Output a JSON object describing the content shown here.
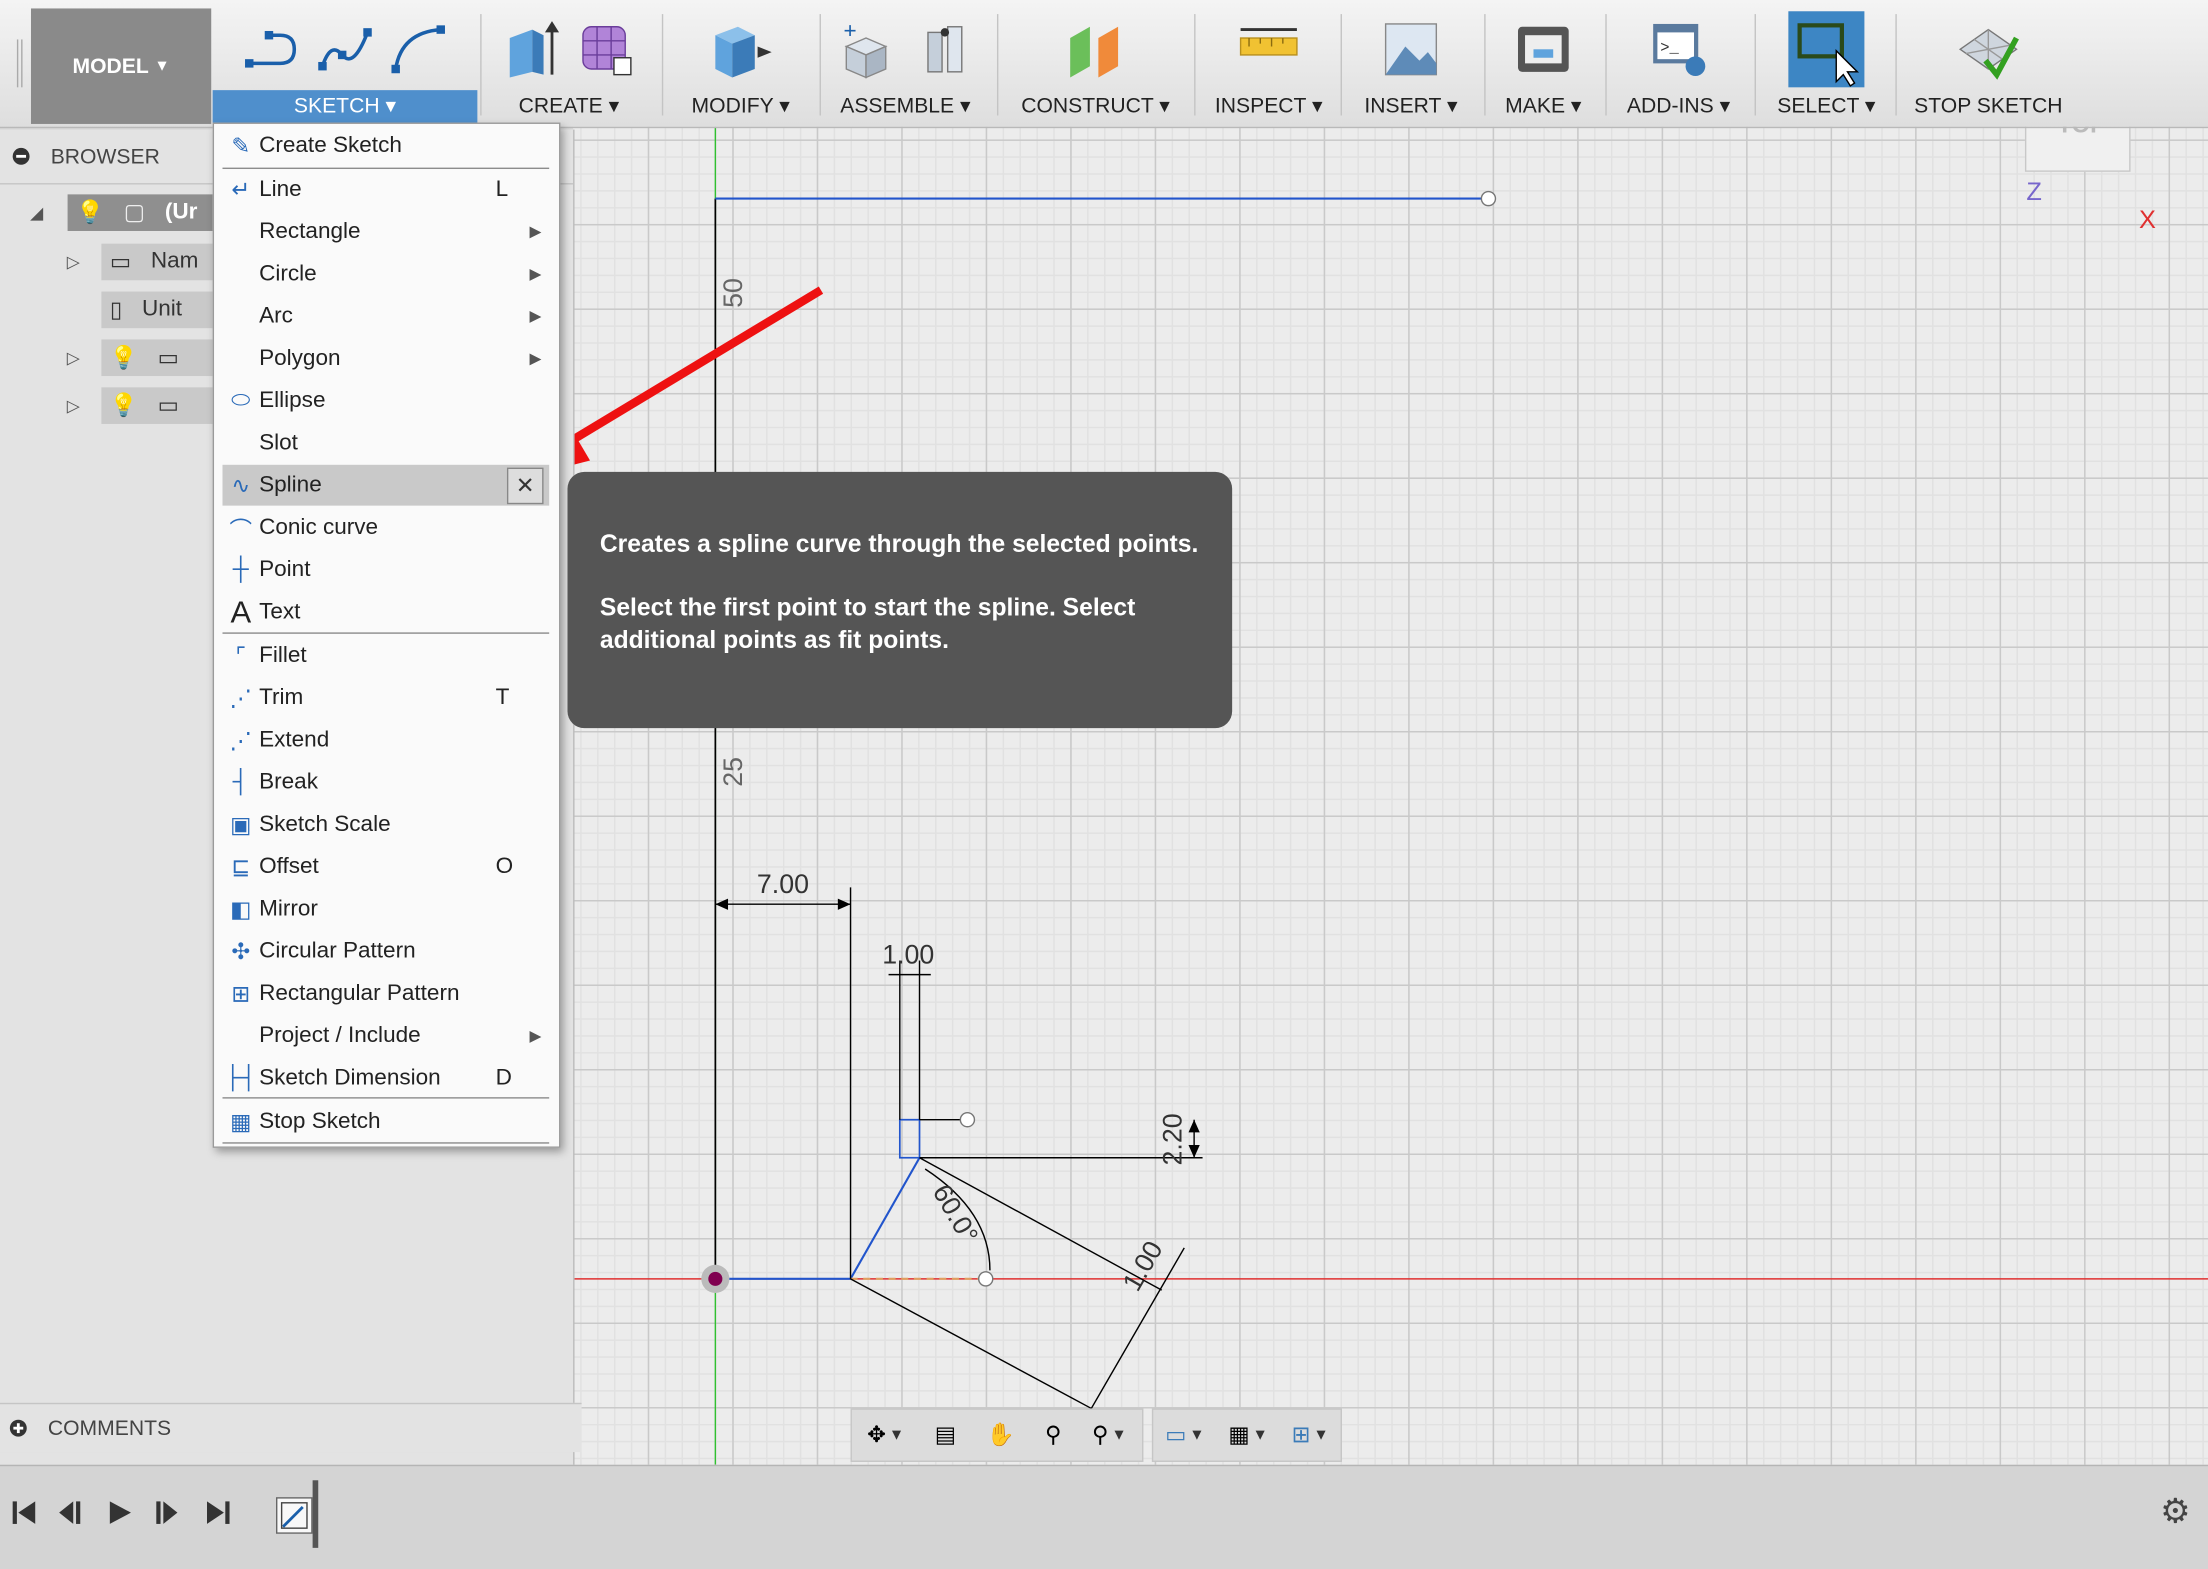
{
  "toolbar": {
    "model_label": "MODEL",
    "groups": [
      {
        "label": "SKETCH"
      },
      {
        "label": "CREATE"
      },
      {
        "label": "MODIFY"
      },
      {
        "label": "ASSEMBLE"
      },
      {
        "label": "CONSTRUCT"
      },
      {
        "label": "INSPECT"
      },
      {
        "label": "INSERT"
      },
      {
        "label": "MAKE"
      },
      {
        "label": "ADD-INS"
      },
      {
        "label": "SELECT"
      },
      {
        "label": "STOP SKETCH"
      }
    ]
  },
  "browser": {
    "title": "BROWSER",
    "rows": [
      {
        "label": "(Ur"
      },
      {
        "label": "Nam"
      },
      {
        "label": "Unit"
      }
    ],
    "comments_label": "COMMENTS"
  },
  "sketch_menu": {
    "items": [
      {
        "label": "Create Sketch",
        "shortcut": ""
      },
      {
        "label": "Line",
        "shortcut": "L"
      },
      {
        "label": "Rectangle",
        "shortcut": ""
      },
      {
        "label": "Circle",
        "shortcut": ""
      },
      {
        "label": "Arc",
        "shortcut": ""
      },
      {
        "label": "Polygon",
        "shortcut": ""
      },
      {
        "label": "Ellipse",
        "shortcut": ""
      },
      {
        "label": "Slot",
        "shortcut": ""
      },
      {
        "label": "Spline",
        "shortcut": ""
      },
      {
        "label": "Conic curve",
        "shortcut": ""
      },
      {
        "label": "Point",
        "shortcut": ""
      },
      {
        "label": "Text",
        "shortcut": ""
      },
      {
        "label": "Fillet",
        "shortcut": ""
      },
      {
        "label": "Trim",
        "shortcut": "T"
      },
      {
        "label": "Extend",
        "shortcut": ""
      },
      {
        "label": "Break",
        "shortcut": ""
      },
      {
        "label": "Sketch Scale",
        "shortcut": ""
      },
      {
        "label": "Offset",
        "shortcut": "O"
      },
      {
        "label": "Mirror",
        "shortcut": ""
      },
      {
        "label": "Circular Pattern",
        "shortcut": ""
      },
      {
        "label": "Rectangular Pattern",
        "shortcut": ""
      },
      {
        "label": "Project / Include",
        "shortcut": ""
      },
      {
        "label": "Sketch Dimension",
        "shortcut": "D"
      },
      {
        "label": "Stop Sketch",
        "shortcut": ""
      }
    ],
    "pin_glyph": "✕",
    "submenu_glyph": "▶"
  },
  "tooltip": {
    "line1": "Creates a spline curve through the selected points.",
    "line2": "Select the first point to start the spline. Select additional points as fit points."
  },
  "canvas": {
    "dimensions": {
      "d50": "50",
      "d25": "25",
      "d7": "7.00",
      "d1": "1.00",
      "d220": "2.20",
      "d60": "60.0°",
      "d100": "1.00"
    },
    "axis_x_label": "X",
    "axis_z_label": "Z",
    "viewcube_label": "TOP"
  },
  "colors": {
    "sketch_line": "#2255cc",
    "axis_red": "#e02020",
    "axis_green": "#30c030",
    "annotation_arrow": "#ee1111",
    "toolbar_active": "#4f8fcc"
  }
}
